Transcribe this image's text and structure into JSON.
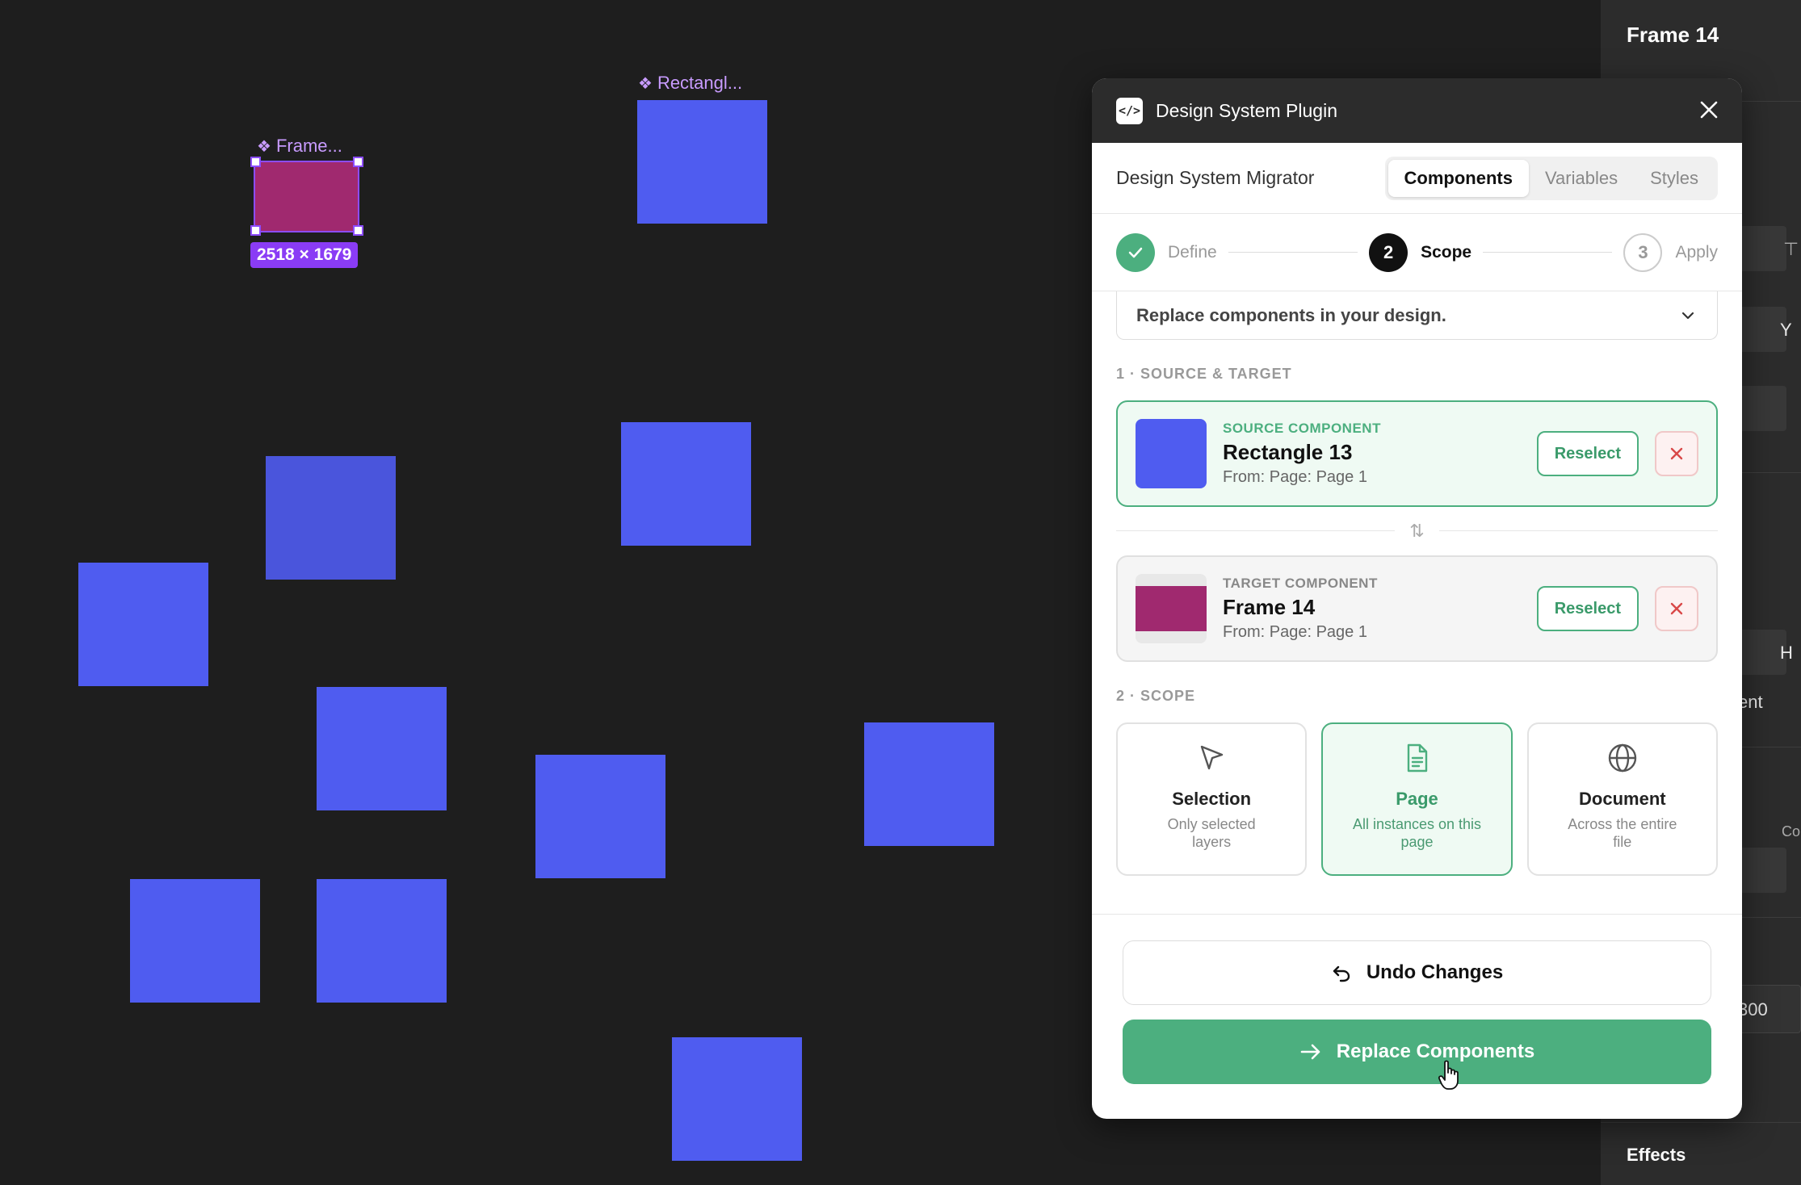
{
  "canvas": {
    "frame_label": "Frame...",
    "rect_label": "Rectangl...",
    "dimensions": "2518 × 1679",
    "square_color": "#4f5cf0",
    "frame_color": "#a0296f"
  },
  "properties": {
    "title": "Frame 14",
    "frag_ent": "ent",
    "frag_co": "Co",
    "frag_300": "300",
    "frag_y": "Y",
    "frag_h": "H",
    "effects": "Effects"
  },
  "plugin": {
    "title": "Design System Plugin",
    "app_name": "Design System Migrator",
    "tabs": [
      "Components",
      "Variables",
      "Styles"
    ],
    "active_tab": "Components",
    "steps": [
      {
        "number": "1",
        "label": "Define",
        "state": "done"
      },
      {
        "number": "2",
        "label": "Scope",
        "state": "current"
      },
      {
        "number": "3",
        "label": "Apply",
        "state": "todo"
      }
    ],
    "description": "Replace components in your design.",
    "section1": "1 · SOURCE & TARGET",
    "source": {
      "kicker": "SOURCE COMPONENT",
      "name": "Rectangle 13",
      "from": "From: Page: Page 1",
      "reselect": "Reselect"
    },
    "target": {
      "kicker": "TARGET COMPONENT",
      "name": "Frame 14",
      "from": "From: Page: Page 1",
      "reselect": "Reselect"
    },
    "section2": "2 · SCOPE",
    "scope_options": [
      {
        "title": "Selection",
        "subtitle": "Only selected layers",
        "icon": "cursor-icon"
      },
      {
        "title": "Page",
        "subtitle": "All instances on this page",
        "icon": "page-icon"
      },
      {
        "title": "Document",
        "subtitle": "Across the entire file",
        "icon": "globe-icon"
      }
    ],
    "selected_scope": "Page",
    "undo_label": "Undo Changes",
    "replace_label": "Replace Components",
    "accent": "#4caf7f"
  }
}
